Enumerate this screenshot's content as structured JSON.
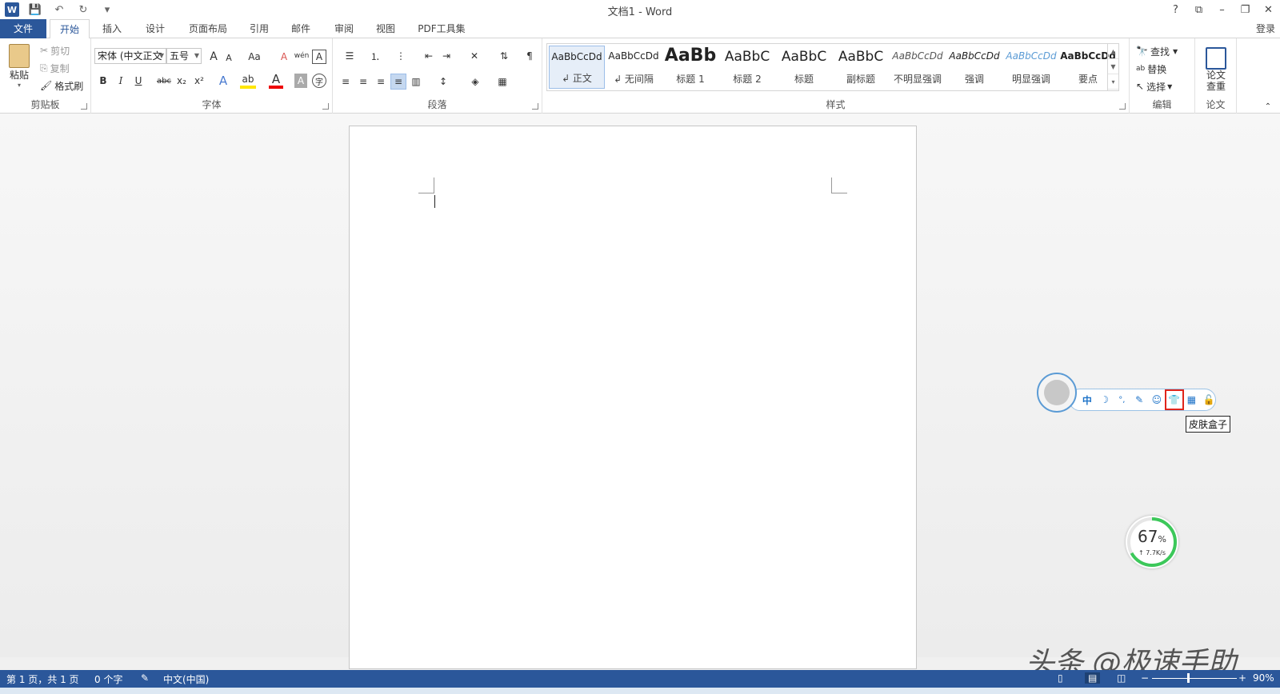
{
  "titlebar": {
    "title": "文档1 - Word",
    "help": "?",
    "restore": "⧉",
    "min": "–",
    "max": "❐",
    "close": "✕"
  },
  "qat": {
    "save": "💾",
    "undo": "↶",
    "redo": "↻",
    "more": "▾"
  },
  "tabs": [
    "文件",
    "开始",
    "插入",
    "设计",
    "页面布局",
    "引用",
    "邮件",
    "审阅",
    "视图",
    "PDF工具集"
  ],
  "login": "登录",
  "clipboard": {
    "label": "剪贴板",
    "paste": "粘贴",
    "cut": "剪切",
    "copy": "复制",
    "format_painter": "格式刷"
  },
  "font": {
    "label": "字体",
    "font_name": "宋体 (中文正文",
    "font_size": "五号",
    "grow": "A",
    "shrink": "A",
    "case": "Aa",
    "clear": "A",
    "phonetic": "wén",
    "border_char": "A",
    "bold": "B",
    "italic": "I",
    "underline": "U",
    "strike": "abc",
    "sub": "x₂",
    "sup": "x²",
    "effects": "A",
    "highlight": "ab",
    "color": "A",
    "shading": "A",
    "enclose": "字"
  },
  "paragraph": {
    "label": "段落"
  },
  "styles": {
    "label": "样式",
    "items": [
      {
        "sample": "AaBbCcDd",
        "name": "↲ 正文"
      },
      {
        "sample": "AaBbCcDd",
        "name": "↲ 无间隔"
      },
      {
        "sample": "AaBb",
        "name": "标题 1"
      },
      {
        "sample": "AaBbC",
        "name": "标题 2"
      },
      {
        "sample": "AaBbC",
        "name": "标题"
      },
      {
        "sample": "AaBbC",
        "name": "副标题"
      },
      {
        "sample": "AaBbCcDd",
        "name": "不明显强调"
      },
      {
        "sample": "AaBbCcDd",
        "name": "强调"
      },
      {
        "sample": "AaBbCcDd",
        "name": "明显强调"
      },
      {
        "sample": "AaBbCcDd",
        "name": "要点"
      }
    ]
  },
  "editing": {
    "label": "编辑",
    "find": "查找",
    "replace": "替换",
    "select": "选择"
  },
  "paper": {
    "label": "论文",
    "check_line1": "论文",
    "check_line2": "查重"
  },
  "ime": {
    "items": [
      "中",
      "☽",
      "°,",
      "✎",
      "☺",
      "👕",
      "▦",
      "🔓"
    ],
    "tooltip": "皮肤盒子"
  },
  "meter": {
    "percent": "67",
    "unit": "%",
    "speed": "↑ 7.7K/s"
  },
  "watermark": "头条 @极速手助",
  "status": {
    "page": "第 1 页，共 1 页",
    "words": "0 个字",
    "lang": "中文(中国)",
    "zoom": "90%",
    "minus": "−",
    "plus": "+"
  },
  "colors": {
    "accent": "#2b579a",
    "highlight_box": "#e0251b"
  }
}
